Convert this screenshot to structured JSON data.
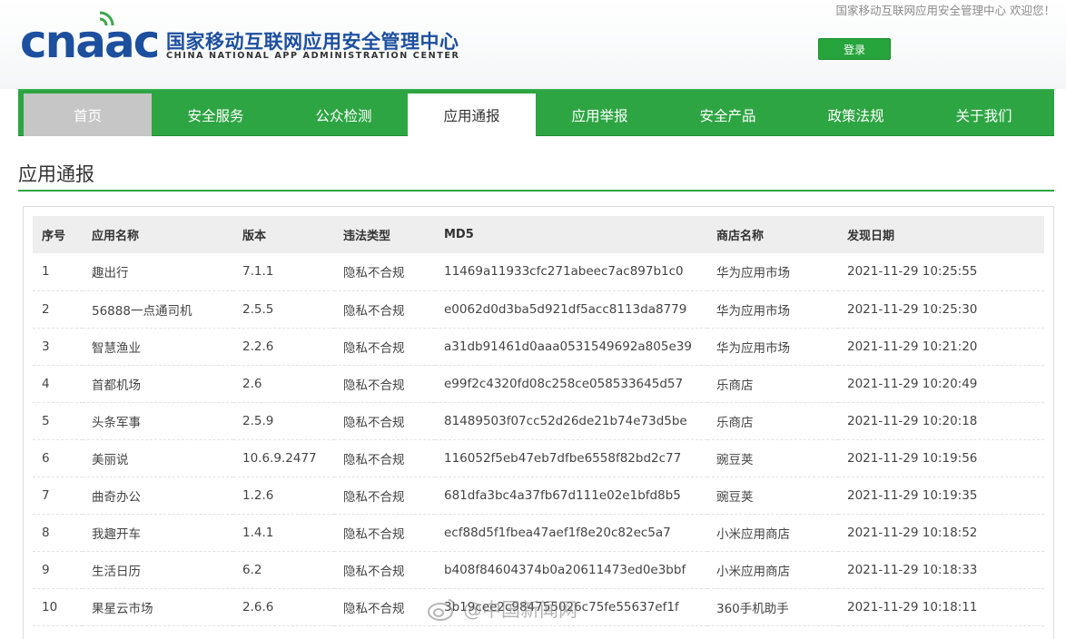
{
  "header": {
    "welcome_text": "国家移动互联网应用安全管理中心 欢迎您！",
    "logo_mark": "cnaac",
    "logo_cn": "国家移动互联网应用安全管理中心",
    "logo_en": "CHINA NATIONAL APP ADMINISTRATION CENTER",
    "login_label": "登录"
  },
  "nav": {
    "items": [
      "首页",
      "安全服务",
      "公众检测",
      "应用通报",
      "应用举报",
      "安全产品",
      "政策法规",
      "关于我们"
    ],
    "active": "应用通报"
  },
  "page": {
    "title": "应用通报"
  },
  "table": {
    "headers": [
      "序号",
      "应用名称",
      "版本",
      "违法类型",
      "MD5",
      "商店名称",
      "发现日期"
    ],
    "rows": [
      [
        "1",
        "趣出行",
        "7.1.1",
        "隐私不合规",
        "11469a11933cfc271abeec7ac897b1c0",
        "华为应用市场",
        "2021-11-29 10:25:55"
      ],
      [
        "2",
        "56888一点通司机",
        "2.5.5",
        "隐私不合规",
        "e0062d0d3ba5d921df5acc8113da8779",
        "华为应用市场",
        "2021-11-29 10:25:30"
      ],
      [
        "3",
        "智慧渔业",
        "2.2.6",
        "隐私不合规",
        "a31db91461d0aaa0531549692a805e39",
        "华为应用市场",
        "2021-11-29 10:21:20"
      ],
      [
        "4",
        "首都机场",
        "2.6",
        "隐私不合规",
        "e99f2c4320fd08c258ce058533645d57",
        "乐商店",
        "2021-11-29 10:20:49"
      ],
      [
        "5",
        "头条军事",
        "2.5.9",
        "隐私不合规",
        "81489503f07cc52d26de21b74e73d5be",
        "乐商店",
        "2021-11-29 10:20:18"
      ],
      [
        "6",
        "美丽说",
        "10.6.9.2477",
        "隐私不合规",
        "116052f5eb47eb7dfbe6558f82bd2c77",
        "豌豆荚",
        "2021-11-29 10:19:56"
      ],
      [
        "7",
        "曲奇办公",
        "1.2.6",
        "隐私不合规",
        "681dfa3bc4a37fb67d111e02e1bfd8b5",
        "豌豆荚",
        "2021-11-29 10:19:35"
      ],
      [
        "8",
        "我趣开车",
        "1.4.1",
        "隐私不合规",
        "ecf88d5f1fbea47aef1f8e20c82ec5a7",
        "小米应用商店",
        "2021-11-29 10:18:52"
      ],
      [
        "9",
        "生活日历",
        "6.2",
        "隐私不合规",
        "b408f84604374b0a20611473ed0e3bbf",
        "小米应用商店",
        "2021-11-29 10:18:33"
      ],
      [
        "10",
        "果星云市场",
        "2.6.6",
        "隐私不合规",
        "3b19cee2c984755026c75fe55637ef1f",
        "360手机助手",
        "2021-11-29 10:18:11"
      ]
    ]
  },
  "watermark": {
    "text": "@中国新闻网"
  },
  "colors": {
    "brand_green": "#2ea543",
    "logo_blue": "#1d4f9f",
    "nav_home_gray": "#c6c6c6"
  }
}
